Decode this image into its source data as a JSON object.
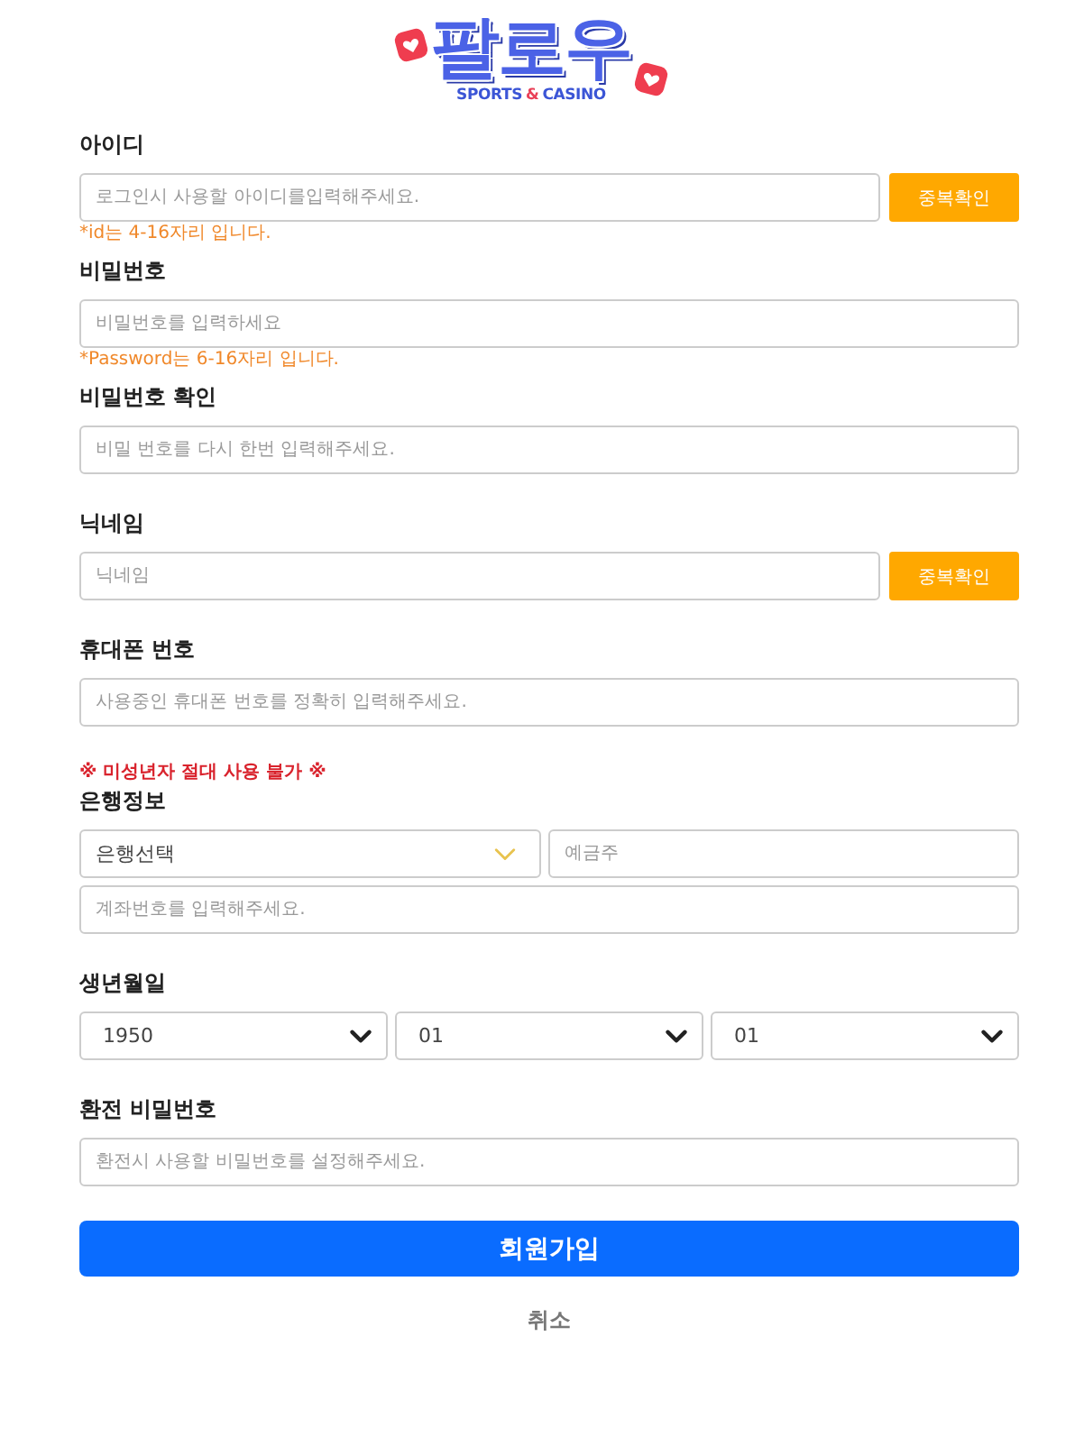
{
  "logo": {
    "title": "팔로우",
    "tagline_left": "SPORTS",
    "tagline_mark": "&",
    "tagline_right": "CASINO"
  },
  "form": [
    {
      "kind": "text",
      "label": "아이디",
      "placeholder": "로그인시 사용할 아이디를입력해주세요.",
      "button": "중복확인",
      "hint": "*id는 4-16자리 입니다."
    },
    {
      "kind": "text",
      "label": "비밀번호",
      "placeholder": "비밀번호를 입력하세요",
      "hint": "*Password는 6-16자리 입니다."
    },
    {
      "kind": "text",
      "label": "비밀번호 확인",
      "placeholder": "비밀 번호를 다시 한번 입력해주세요."
    },
    {
      "kind": "text",
      "label": "닉네임",
      "placeholder": "닉네임",
      "button": "중복확인"
    },
    {
      "kind": "text",
      "label": "휴대폰 번호",
      "placeholder": "사용중인 휴대폰 번호를 정확히 입력해주세요."
    },
    {
      "kind": "bank",
      "notice": "※ 미성년자 절대 사용 불가 ※",
      "label": "은행정보",
      "bank_select": "은행선택",
      "holder_placeholder": "예금주",
      "account_placeholder": "계좌번호를 입력해주세요."
    },
    {
      "kind": "birth",
      "label": "생년월일",
      "selects": [
        "1950",
        "01",
        "01"
      ]
    },
    {
      "kind": "text",
      "label": "환전 비밀번호",
      "placeholder": "환전시 사용할 비밀번호를 설정해주세요."
    }
  ],
  "submit_button": "회원가입",
  "cancel_button": "취소"
}
